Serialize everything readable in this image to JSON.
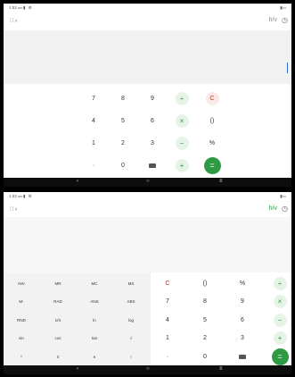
{
  "status": {
    "time": "1:53",
    "time_suffix": "am",
    "icons": "▮ ⚙",
    "right": "▮▭"
  },
  "app": {
    "mode_icon": "∷",
    "chevron": "˅",
    "graph_icon": "h/v",
    "history_icon": "◷"
  },
  "colors": {
    "accent": "#2f9a44",
    "clear": "#c0392b"
  },
  "portrait_keys": [
    [
      "7",
      "8",
      "9",
      "÷",
      "C"
    ],
    [
      "4",
      "5",
      "6",
      "×",
      "()"
    ],
    [
      "1",
      "2",
      "3",
      "−",
      "%"
    ],
    [
      "·",
      "0",
      "⌫",
      "+",
      "="
    ]
  ],
  "sci_keys": [
    [
      "INV",
      "MR",
      "MC",
      "MS"
    ],
    [
      "M-",
      "RAD",
      "ANS",
      "ABS"
    ],
    [
      "RND",
      "1/X",
      "ln",
      "log"
    ],
    [
      "sin",
      "cos",
      "tan",
      "√"
    ],
    [
      "^",
      "π",
      "e",
      "!"
    ]
  ],
  "landscape_keys": [
    [
      "C",
      "()",
      "%",
      "÷"
    ],
    [
      "7",
      "8",
      "9",
      "×"
    ],
    [
      "4",
      "5",
      "6",
      "−"
    ],
    [
      "1",
      "2",
      "3",
      "+"
    ],
    [
      "·",
      "0",
      "⌫",
      "="
    ]
  ],
  "nav": {
    "back": "‹",
    "home": "○",
    "menu": "≡"
  }
}
